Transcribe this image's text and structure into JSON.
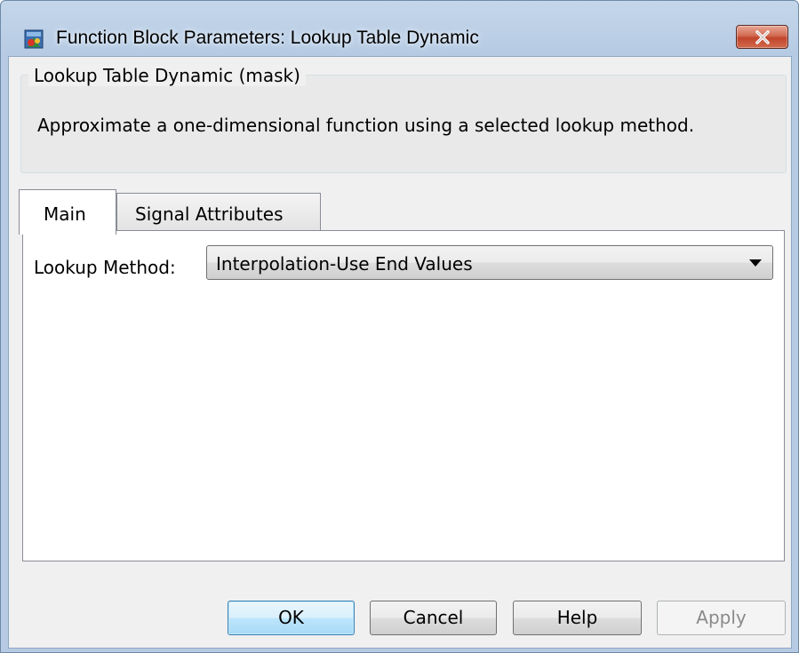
{
  "window": {
    "title": "Function Block Parameters: Lookup Table Dynamic",
    "title_icon": "simulink-block-icon",
    "close_icon": "close-icon"
  },
  "mask": {
    "group_title": "Lookup Table Dynamic (mask)",
    "description": "Approximate a one-dimensional function using a selected lookup method."
  },
  "tabs": [
    {
      "label": "Main",
      "selected": true
    },
    {
      "label": "Signal Attributes",
      "selected": false
    }
  ],
  "main": {
    "lookup_method_label": "Lookup Method:",
    "lookup_method_value": "Interpolation-Use End Values"
  },
  "buttons": {
    "ok": "OK",
    "cancel": "Cancel",
    "help": "Help",
    "apply": "Apply"
  },
  "colors": {
    "default_button": "#a7d9f5",
    "close_button": "#c0452c",
    "frame": "#b6cbe3"
  }
}
